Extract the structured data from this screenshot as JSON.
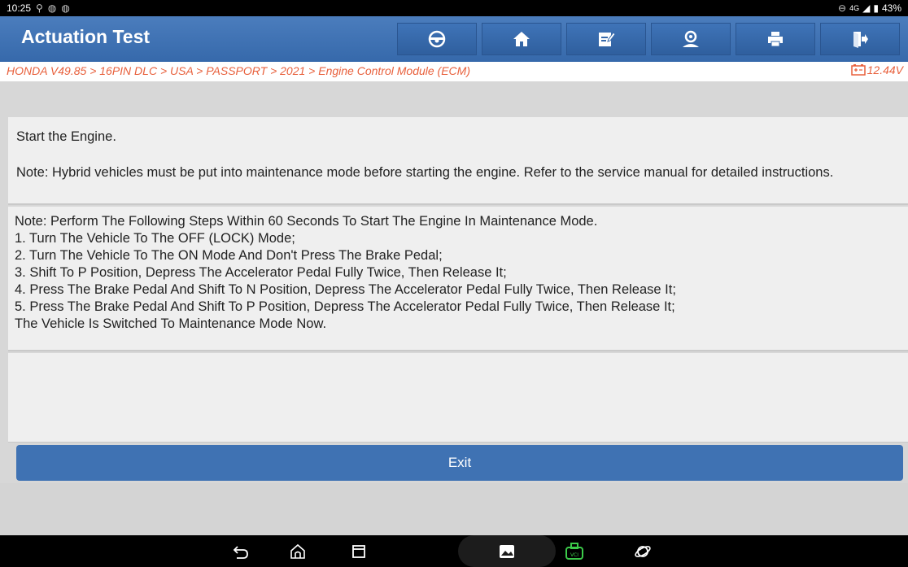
{
  "status_bar": {
    "time": "10:25",
    "network": "4G",
    "battery": "43%"
  },
  "header": {
    "title": "Actuation Test",
    "toolbar": [
      {
        "icon": "steering-wheel-icon"
      },
      {
        "icon": "home-icon"
      },
      {
        "icon": "edit-report-icon"
      },
      {
        "icon": "user-support-icon"
      },
      {
        "icon": "print-icon"
      },
      {
        "icon": "exit-door-icon"
      }
    ]
  },
  "breadcrumb": {
    "path": "HONDA V49.85 > 16PIN DLC > USA > PASSPORT > 2021 > Engine Control Module (ECM)",
    "voltage": "12.44V"
  },
  "panel1": {
    "instruction": "Start the Engine.",
    "note": "Note: Hybrid vehicles must be put into maintenance mode before starting the engine. Refer to the service manual for detailed instructions."
  },
  "panel2": {
    "lines": [
      " Note: Perform The Following Steps Within 60 Seconds To Start The Engine In Maintenance Mode.",
      "1. Turn The Vehicle To The OFF (LOCK) Mode;",
      "2. Turn The Vehicle To The ON Mode And Don't Press The Brake Pedal;",
      "3. Shift To P Position, Depress The Accelerator Pedal Fully Twice, Then Release It;",
      "4. Press The Brake Pedal And Shift To N Position, Depress The Accelerator Pedal Fully Twice, Then Release It;",
      "5. Press The Brake Pedal And Shift To P Position, Depress The Accelerator Pedal Fully Twice, Then Release It;",
      "The Vehicle Is Switched To Maintenance Mode Now."
    ]
  },
  "footer": {
    "exit_label": "Exit"
  },
  "colors": {
    "accent": "#3f72b3",
    "breadcrumb": "#e8603c",
    "vci": "#3ccb4a"
  }
}
